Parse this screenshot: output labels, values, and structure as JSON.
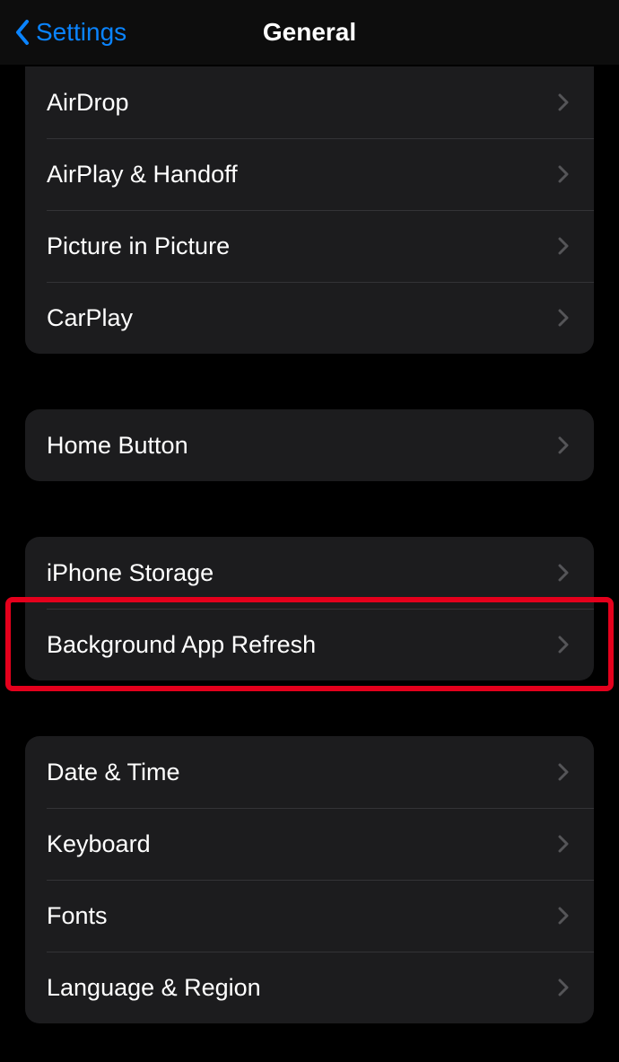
{
  "nav": {
    "back_label": "Settings",
    "title": "General"
  },
  "sections": {
    "group1": {
      "items": [
        {
          "label": "AirDrop"
        },
        {
          "label": "AirPlay & Handoff"
        },
        {
          "label": "Picture in Picture"
        },
        {
          "label": "CarPlay"
        }
      ]
    },
    "group2": {
      "items": [
        {
          "label": "Home Button"
        }
      ]
    },
    "group3": {
      "items": [
        {
          "label": "iPhone Storage"
        },
        {
          "label": "Background App Refresh"
        }
      ]
    },
    "group4": {
      "items": [
        {
          "label": "Date & Time"
        },
        {
          "label": "Keyboard"
        },
        {
          "label": "Fonts"
        },
        {
          "label": "Language & Region"
        }
      ]
    }
  },
  "highlighted_item": "Background App Refresh"
}
